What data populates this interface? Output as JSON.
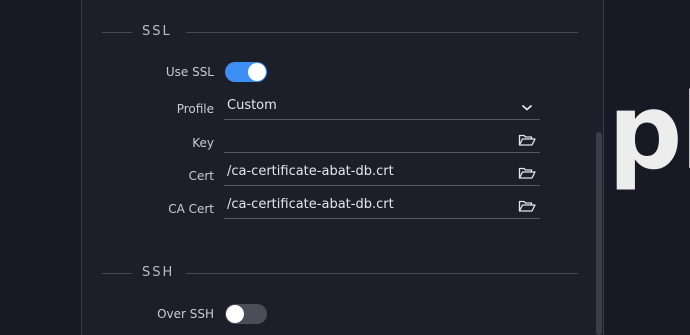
{
  "background": {
    "brand_fragment": "pl"
  },
  "ssl": {
    "title": "SSL",
    "use_ssl_label": "Use SSL",
    "use_ssl_enabled": true,
    "profile_label": "Profile",
    "profile_value": "Custom",
    "key_label": "Key",
    "key_value": "",
    "cert_label": "Cert",
    "cert_value": "/ca-certificate-abat-db.crt",
    "ca_cert_label": "CA Cert",
    "ca_cert_value": "/ca-certificate-abat-db.crt"
  },
  "ssh": {
    "title": "SSH",
    "over_ssh_label": "Over SSH",
    "over_ssh_enabled": false
  },
  "icons": {
    "profile_dropdown": "chevron-down-icon",
    "file_browse": "folder-open-icon"
  },
  "colors": {
    "accent": "#3d8ef5",
    "panel": "#1c1f2a",
    "background": "#171a24"
  }
}
